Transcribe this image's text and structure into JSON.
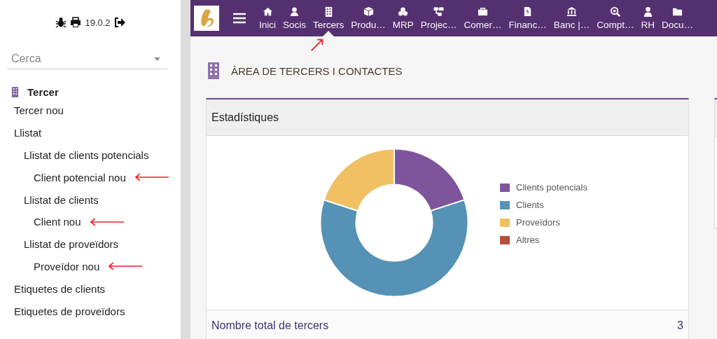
{
  "sidebar": {
    "version": "19.0.2",
    "search": {
      "placeholder": "Cerca"
    },
    "section": {
      "title": "Tercer"
    },
    "items": [
      {
        "label": "Tercer nou",
        "marked": false
      },
      {
        "label": "Llistat",
        "marked": false,
        "children": [
          {
            "label": "Llistat de clients potencials",
            "marked": false,
            "children": [
              {
                "label": "Client potencial nou",
                "marked": true
              }
            ]
          },
          {
            "label": "Llistat de clients",
            "marked": false,
            "children": [
              {
                "label": "Client nou",
                "marked": true
              }
            ]
          },
          {
            "label": "Llistat de proveïdors",
            "marked": false,
            "children": [
              {
                "label": "Proveïdor nou",
                "marked": true
              }
            ]
          }
        ]
      },
      {
        "label": "Etiquetes de clients",
        "marked": false
      },
      {
        "label": "Etiquetes de proveïdors",
        "marked": false
      }
    ]
  },
  "topbar": {
    "tabs": [
      {
        "label": "Inici",
        "selected": false,
        "marked": false
      },
      {
        "label": "Socis",
        "selected": false,
        "marked": false
      },
      {
        "label": "Tercers",
        "selected": true,
        "marked": true
      },
      {
        "label": "Produ…",
        "selected": false,
        "marked": false
      },
      {
        "label": "MRP",
        "selected": false,
        "marked": false
      },
      {
        "label": "Projec…",
        "selected": false,
        "marked": false
      },
      {
        "label": "Comer…",
        "selected": false,
        "marked": false
      },
      {
        "label": "Financ…",
        "selected": false,
        "marked": false
      },
      {
        "label": "Banc |…",
        "selected": false,
        "marked": false
      },
      {
        "label": "Compt…",
        "selected": false,
        "marked": false
      },
      {
        "label": "RH",
        "selected": false,
        "marked": false
      },
      {
        "label": "Docu…",
        "selected": false,
        "marked": false
      }
    ]
  },
  "page": {
    "title": "ÀREA DE TERCERS I CONTACTES",
    "stats_card": {
      "title": "Estadístiques",
      "legend": [
        {
          "label": "Clients potencials",
          "color": "#7e559c"
        },
        {
          "label": "Clients",
          "color": "#5592b5"
        },
        {
          "label": "Proveïdors",
          "color": "#f0c063"
        },
        {
          "label": "Altres",
          "color": "#b84d3f"
        }
      ],
      "footer": {
        "label": "Nombre total de tercers",
        "value": "3"
      }
    }
  }
}
